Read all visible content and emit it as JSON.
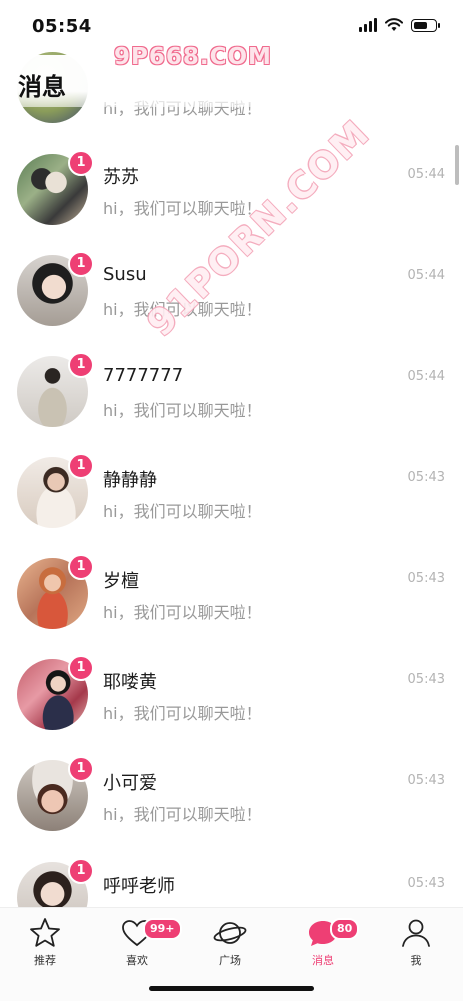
{
  "status_bar": {
    "time": "05:54",
    "battery_level": 0.7
  },
  "watermarks": {
    "top": "9P668.COM",
    "diagonal": "91PORN.COM"
  },
  "header": {
    "title": "消息"
  },
  "conversations": [
    {
      "name": "",
      "preview": "hi，我们可以聊天啦！",
      "time": "",
      "unread": ""
    },
    {
      "name": "苏苏",
      "preview": "hi，我们可以聊天啦！",
      "time": "05:44",
      "unread": "1"
    },
    {
      "name": "Susu",
      "preview": "hi，我们可以聊天啦！",
      "time": "05:44",
      "unread": "1"
    },
    {
      "name": "7777777",
      "preview": "hi，我们可以聊天啦！",
      "time": "05:44",
      "unread": "1"
    },
    {
      "name": "静静静",
      "preview": "hi，我们可以聊天啦！",
      "time": "05:43",
      "unread": "1"
    },
    {
      "name": "岁檀",
      "preview": "hi，我们可以聊天啦！",
      "time": "05:43",
      "unread": "1"
    },
    {
      "name": "耶喽黄",
      "preview": "hi，我们可以聊天啦！",
      "time": "05:43",
      "unread": "1"
    },
    {
      "name": "小可爱",
      "preview": "hi，我们可以聊天啦！",
      "time": "05:43",
      "unread": "1"
    },
    {
      "name": "呼呼老师",
      "preview": "",
      "time": "05:43",
      "unread": "1"
    }
  ],
  "tabbar": {
    "tabs": [
      {
        "label": "推荐",
        "icon": "star-icon",
        "badge": ""
      },
      {
        "label": "喜欢",
        "icon": "heart-icon",
        "badge": "99+"
      },
      {
        "label": "广场",
        "icon": "planet-icon",
        "badge": ""
      },
      {
        "label": "消息",
        "icon": "chat-bubble-icon",
        "badge": "80"
      },
      {
        "label": "我",
        "icon": "person-icon",
        "badge": ""
      }
    ]
  },
  "colors": {
    "accent": "#ee3f74",
    "time_text": "#b3b3b3",
    "preview_text": "#999999"
  }
}
